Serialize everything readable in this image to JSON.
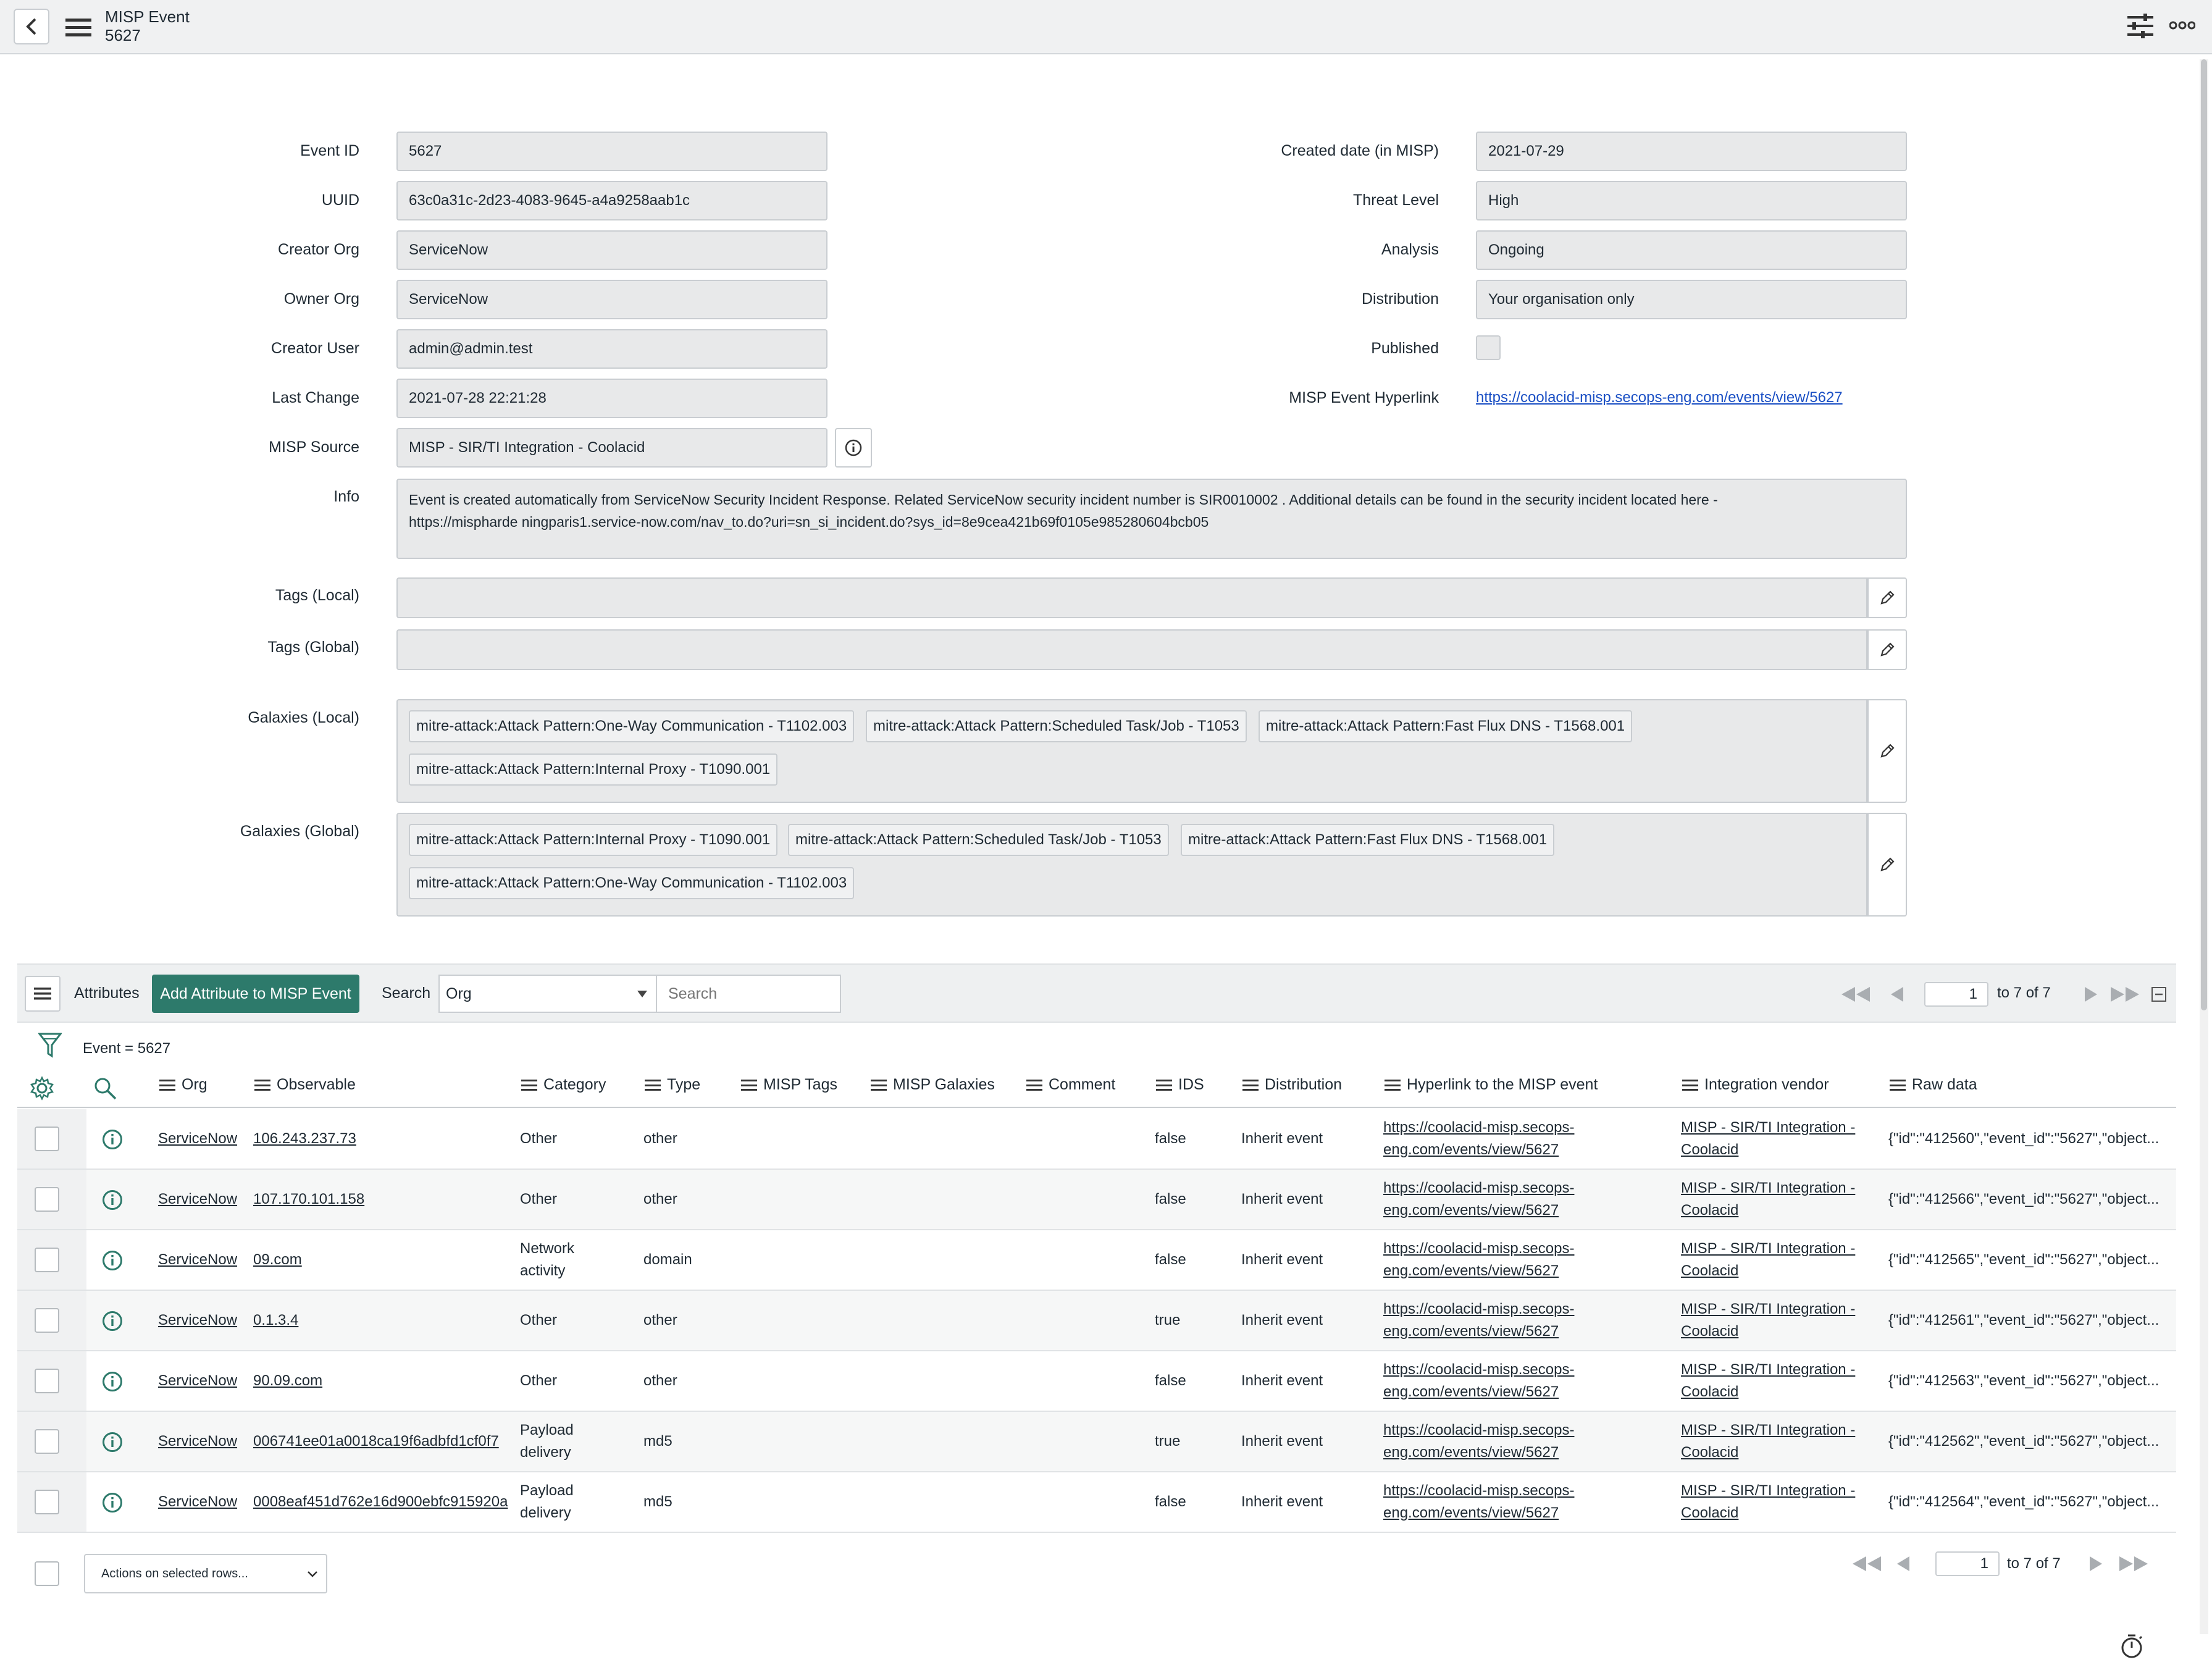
{
  "header": {
    "title": "MISP Event",
    "subtitle": "5627"
  },
  "form": {
    "event_id": {
      "label": "Event ID",
      "value": "5627"
    },
    "uuid": {
      "label": "UUID",
      "value": "63c0a31c-2d23-4083-9645-a4a9258aab1c"
    },
    "creator_org": {
      "label": "Creator Org",
      "value": "ServiceNow"
    },
    "owner_org": {
      "label": "Owner Org",
      "value": "ServiceNow"
    },
    "creator_user": {
      "label": "Creator User",
      "value": "admin@admin.test"
    },
    "last_change": {
      "label": "Last Change",
      "value": "2021-07-28 22:21:28"
    },
    "misp_source": {
      "label": "MISP Source",
      "value": "MISP - SIR/TI Integration - Coolacid"
    },
    "info": {
      "label": "Info",
      "line1": "Event is created automatically from ServiceNow Security Incident Response. Related ServiceNow security incident number is SIR0010002 . Additional details can be found in the security incident located here -",
      "line2": "https://mispharde ningparis1.service-now.com/nav_to.do?uri=sn_si_incident.do?sys_id=8e9cea421b69f0105e985280604bcb05"
    },
    "created_date": {
      "label": "Created date (in MISP)",
      "value": "2021-07-29"
    },
    "threat_level": {
      "label": "Threat Level",
      "value": "High"
    },
    "analysis": {
      "label": "Analysis",
      "value": "Ongoing"
    },
    "distribution": {
      "label": "Distribution",
      "value": "Your organisation only"
    },
    "published": {
      "label": "Published",
      "checked": false
    },
    "hyperlink": {
      "label": "MISP Event Hyperlink",
      "value": "https://coolacid-misp.secops-eng.com/events/view/5627"
    },
    "tags_local": {
      "label": "Tags (Local)"
    },
    "tags_global": {
      "label": "Tags (Global)"
    },
    "galaxies_local": {
      "label": "Galaxies (Local)",
      "chips": [
        "mitre-attack:Attack Pattern:One-Way Communication - T1102.003",
        "mitre-attack:Attack Pattern:Scheduled Task/Job - T1053",
        "mitre-attack:Attack Pattern:Fast Flux DNS - T1568.001",
        "mitre-attack:Attack Pattern:Internal Proxy - T1090.001"
      ]
    },
    "galaxies_global": {
      "label": "Galaxies (Global)",
      "chips": [
        "mitre-attack:Attack Pattern:Internal Proxy - T1090.001",
        "mitre-attack:Attack Pattern:Scheduled Task/Job - T1053",
        "mitre-attack:Attack Pattern:Fast Flux DNS - T1568.001",
        "mitre-attack:Attack Pattern:One-Way Communication - T1102.003"
      ]
    }
  },
  "list": {
    "title": "Attributes",
    "add_button": "Add Attribute to MISP Event",
    "search_label": "Search",
    "search_field": "Org",
    "search_placeholder": "Search",
    "page": "1",
    "page_of": "to 7 of 7",
    "filter": "Event = 5627",
    "columns": [
      "Org",
      "Observable",
      "Category",
      "Type",
      "MISP Tags",
      "MISP Galaxies",
      "Comment",
      "IDS",
      "Distribution",
      "Hyperlink to the MISP event",
      "Integration vendor",
      "Raw data"
    ],
    "rows": [
      {
        "org": "ServiceNow",
        "observable": "106.243.237.73",
        "category": [
          "Other"
        ],
        "type": "other",
        "ids": "false",
        "distribution": "Inherit event",
        "hyperlink": [
          "https://coolacid-misp.secops-",
          "eng.com/events/view/5627"
        ],
        "vendor": [
          "MISP - SIR/TI Integration -",
          "Coolacid"
        ],
        "raw": "{\"id\":\"412560\",\"event_id\":\"5627\",\"object..."
      },
      {
        "org": "ServiceNow",
        "observable": "107.170.101.158",
        "category": [
          "Other"
        ],
        "type": "other",
        "ids": "false",
        "distribution": "Inherit event",
        "hyperlink": [
          "https://coolacid-misp.secops-",
          "eng.com/events/view/5627"
        ],
        "vendor": [
          "MISP - SIR/TI Integration -",
          "Coolacid"
        ],
        "raw": "{\"id\":\"412566\",\"event_id\":\"5627\",\"object..."
      },
      {
        "org": "ServiceNow",
        "observable": "09.com",
        "category": [
          "Network",
          "activity"
        ],
        "type": "domain",
        "ids": "false",
        "distribution": "Inherit event",
        "hyperlink": [
          "https://coolacid-misp.secops-",
          "eng.com/events/view/5627"
        ],
        "vendor": [
          "MISP - SIR/TI Integration -",
          "Coolacid"
        ],
        "raw": "{\"id\":\"412565\",\"event_id\":\"5627\",\"object..."
      },
      {
        "org": "ServiceNow",
        "observable": "0.1.3.4",
        "category": [
          "Other"
        ],
        "type": "other",
        "ids": "true",
        "distribution": "Inherit event",
        "hyperlink": [
          "https://coolacid-misp.secops-",
          "eng.com/events/view/5627"
        ],
        "vendor": [
          "MISP - SIR/TI Integration -",
          "Coolacid"
        ],
        "raw": "{\"id\":\"412561\",\"event_id\":\"5627\",\"object..."
      },
      {
        "org": "ServiceNow",
        "observable": "90.09.com",
        "category": [
          "Other"
        ],
        "type": "other",
        "ids": "false",
        "distribution": "Inherit event",
        "hyperlink": [
          "https://coolacid-misp.secops-",
          "eng.com/events/view/5627"
        ],
        "vendor": [
          "MISP - SIR/TI Integration -",
          "Coolacid"
        ],
        "raw": "{\"id\":\"412563\",\"event_id\":\"5627\",\"object..."
      },
      {
        "org": "ServiceNow",
        "observable": "006741ee01a0018ca19f6adbfd1cf0f7",
        "category": [
          "Payload",
          "delivery"
        ],
        "type": "md5",
        "ids": "true",
        "distribution": "Inherit event",
        "hyperlink": [
          "https://coolacid-misp.secops-",
          "eng.com/events/view/5627"
        ],
        "vendor": [
          "MISP - SIR/TI Integration -",
          "Coolacid"
        ],
        "raw": "{\"id\":\"412562\",\"event_id\":\"5627\",\"object..."
      },
      {
        "org": "ServiceNow",
        "observable": "0008eaf451d762e16d900ebfc915920a",
        "category": [
          "Payload",
          "delivery"
        ],
        "type": "md5",
        "ids": "false",
        "distribution": "Inherit event",
        "hyperlink": [
          "https://coolacid-misp.secops-",
          "eng.com/events/view/5627"
        ],
        "vendor": [
          "MISP - SIR/TI Integration -",
          "Coolacid"
        ],
        "raw": "{\"id\":\"412564\",\"event_id\":\"5627\",\"object..."
      }
    ],
    "actions_select": "Actions on selected rows...",
    "footer_page": "1",
    "footer_page_of": "to 7 of 7"
  },
  "colors": {
    "accent": "#2d7a6b",
    "link": "#1a4fc4",
    "field_bg": "#e8e9ea"
  }
}
